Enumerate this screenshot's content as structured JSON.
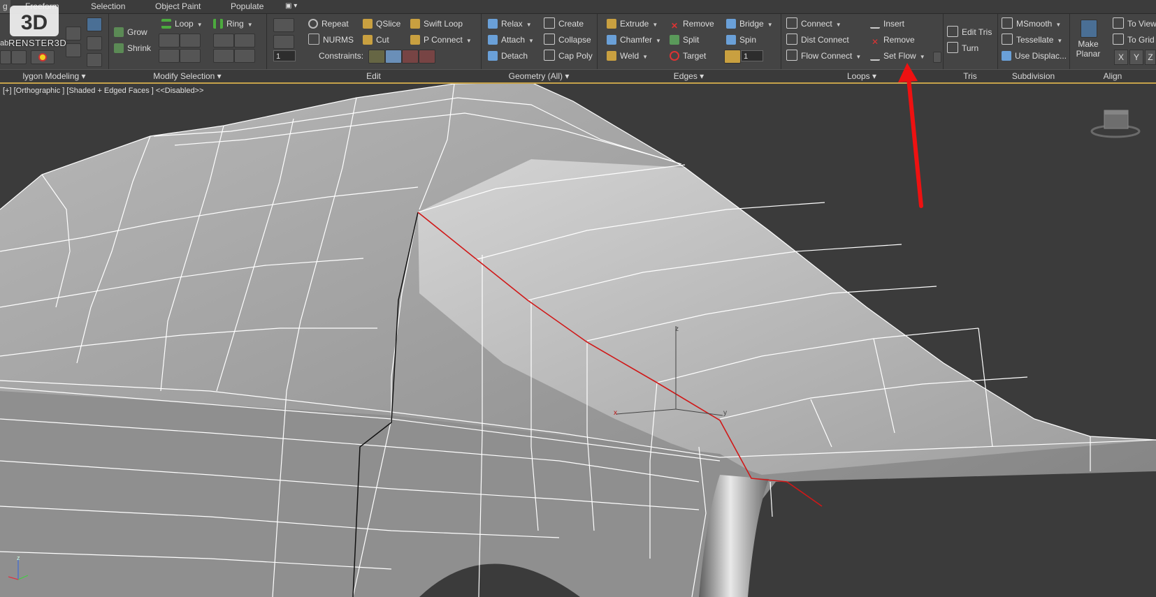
{
  "tabs": [
    {
      "label": "g",
      "active": true
    },
    {
      "label": "Freeform"
    },
    {
      "label": "Selection"
    },
    {
      "label": "Object Paint"
    },
    {
      "label": "Populate"
    }
  ],
  "logo": {
    "mark": "3D",
    "text": "RENSTER3D",
    "partial_label": "ab"
  },
  "groups": {
    "polygon_modeling": "lygon Modeling",
    "modify_selection": "Modify Selection",
    "edit": "Edit",
    "geometry": "Geometry (All)",
    "edges": "Edges",
    "loops": "Loops",
    "tris": "Tris",
    "subdivision": "Subdivision",
    "align": "Align"
  },
  "modify_selection": {
    "grow": "Grow",
    "shrink": "Shrink",
    "loop": "Loop",
    "ring": "Ring"
  },
  "edit": {
    "repeat": "Repeat",
    "qslice": "QSlice",
    "swift_loop": "Swift Loop",
    "nurms": "NURMS",
    "cut": "Cut",
    "p_connect": "P Connect",
    "constraints": "Constraints:",
    "spinner_value": "1"
  },
  "geometry": {
    "relax": "Relax",
    "create": "Create",
    "attach": "Attach",
    "collapse": "Collapse",
    "detach": "Detach",
    "cap_poly": "Cap Poly"
  },
  "edges": {
    "extrude": "Extrude",
    "remove": "Remove",
    "bridge": "Bridge",
    "chamfer": "Chamfer",
    "split": "Split",
    "spin": "Spin",
    "weld": "Weld",
    "target": "Target",
    "spinner_value": "1"
  },
  "loops": {
    "connect": "Connect",
    "insert": "Insert",
    "dist_connect": "Dist Connect",
    "remove": "Remove",
    "flow_connect": "Flow Connect",
    "set_flow": "Set  Flow"
  },
  "tris": {
    "edit_tris": "Edit Tris",
    "turn": "Turn"
  },
  "subdivision": {
    "msmooth": "MSmooth",
    "tessellate": "Tessellate",
    "use_displace": "Use Displac..."
  },
  "align": {
    "make_planar": "Make Planar",
    "to_view": "To View",
    "to_grid": "To Grid",
    "x": "X",
    "y": "Y",
    "z": "Z"
  },
  "viewport": {
    "label": "[+] [Orthographic ] [Shaded + Edged Faces ]  <<Disabled>>",
    "gizmo": {
      "x": "x",
      "y": "y",
      "z": "z"
    }
  },
  "colors": {
    "accent_line": "#c6a24a",
    "selected_edge": "#d01818",
    "annotation_arrow": "#ee1111"
  }
}
